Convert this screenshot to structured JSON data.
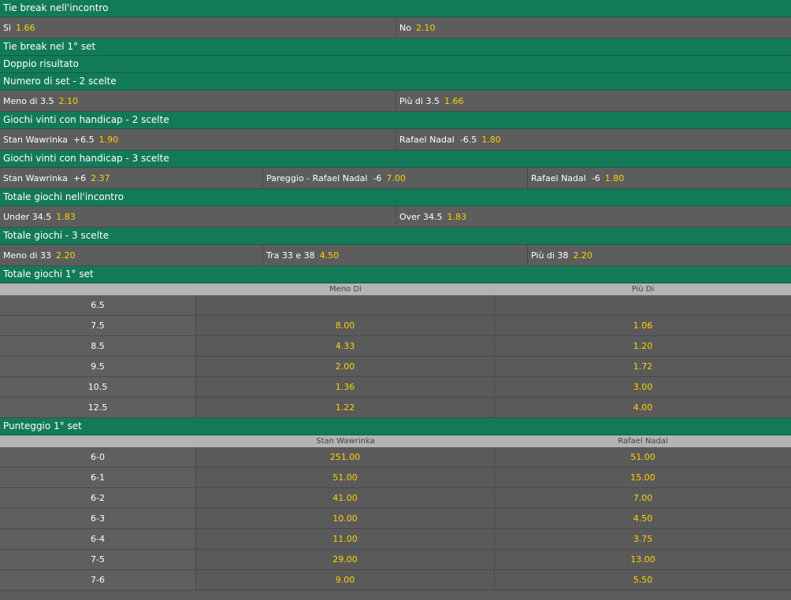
{
  "markets": {
    "tie_break_match": {
      "title": "Tie break nell'incontro",
      "options": [
        {
          "label": "Sì",
          "odd": "1.66"
        },
        {
          "label": "No",
          "odd": "2.10"
        }
      ]
    },
    "tie_break_set1": {
      "title": "Tie break nel 1° set"
    },
    "double_result": {
      "title": "Doppio risultato"
    },
    "number_of_sets": {
      "title": "Numero di set - 2 scelte",
      "options": [
        {
          "label": "Meno di 3.5",
          "odd": "2.10"
        },
        {
          "label": "Più di 3.5",
          "odd": "1.66"
        }
      ]
    },
    "handicap_2": {
      "title": "Giochi vinti con handicap - 2 scelte",
      "options": [
        {
          "label": "Stan Wawrinka  +6.5",
          "odd": "1.90"
        },
        {
          "label": "Rafael Nadal  -6.5",
          "odd": "1.80"
        }
      ]
    },
    "handicap_3": {
      "title": "Giochi vinti con handicap - 3 scelte",
      "options": [
        {
          "label": "Stan Wawrinka  +6",
          "odd": "2.37"
        },
        {
          "label": "Pareggio - Rafael Nadal  -6",
          "odd": "7.00"
        },
        {
          "label": "Rafael Nadal  -6",
          "odd": "1.80"
        }
      ]
    },
    "total_games": {
      "title": "Totale giochi nell'incontro",
      "options": [
        {
          "label": "Under 34.5",
          "odd": "1.83"
        },
        {
          "label": "Over 34.5",
          "odd": "1.83"
        }
      ]
    },
    "total_games_3": {
      "title": "Totale giochi - 3 scelte",
      "options": [
        {
          "label": "Meno di 33",
          "odd": "2.20"
        },
        {
          "label": "Tra 33 e 38",
          "odd": "4.50"
        },
        {
          "label": "Più di 38",
          "odd": "2.20"
        }
      ]
    },
    "total_games_set1": {
      "title": "Totale giochi 1° set",
      "columns": [
        "",
        "Meno Di",
        "Più Di"
      ],
      "rows": [
        {
          "line": "6.5",
          "under": "",
          "over": ""
        },
        {
          "line": "7.5",
          "under": "8.00",
          "over": "1.06"
        },
        {
          "line": "8.5",
          "under": "4.33",
          "over": "1.20"
        },
        {
          "line": "9.5",
          "under": "2.00",
          "over": "1.72"
        },
        {
          "line": "10.5",
          "under": "1.36",
          "over": "3.00"
        },
        {
          "line": "12.5",
          "under": "1.22",
          "over": "4.00"
        }
      ]
    },
    "set1_score": {
      "title": "Punteggio 1° set",
      "columns": [
        "",
        "Stan Wawrinka",
        "Rafael Nadal"
      ],
      "rows": [
        {
          "score": "6-0",
          "p1": "251.00",
          "p2": "51.00"
        },
        {
          "score": "6-1",
          "p1": "51.00",
          "p2": "15.00"
        },
        {
          "score": "6-2",
          "p1": "41.00",
          "p2": "7.00"
        },
        {
          "score": "6-3",
          "p1": "10.00",
          "p2": "4.50"
        },
        {
          "score": "6-4",
          "p1": "11.00",
          "p2": "3.75"
        },
        {
          "score": "7-5",
          "p1": "29.00",
          "p2": "13.00"
        },
        {
          "score": "7-6",
          "p1": "9.00",
          "p2": "5.50"
        }
      ]
    }
  },
  "colors": {
    "header_green": "#137a58",
    "odd_yellow": "#ffd200",
    "row_grey": "#5d5d5d",
    "col_header_grey": "#b4b4b4"
  }
}
